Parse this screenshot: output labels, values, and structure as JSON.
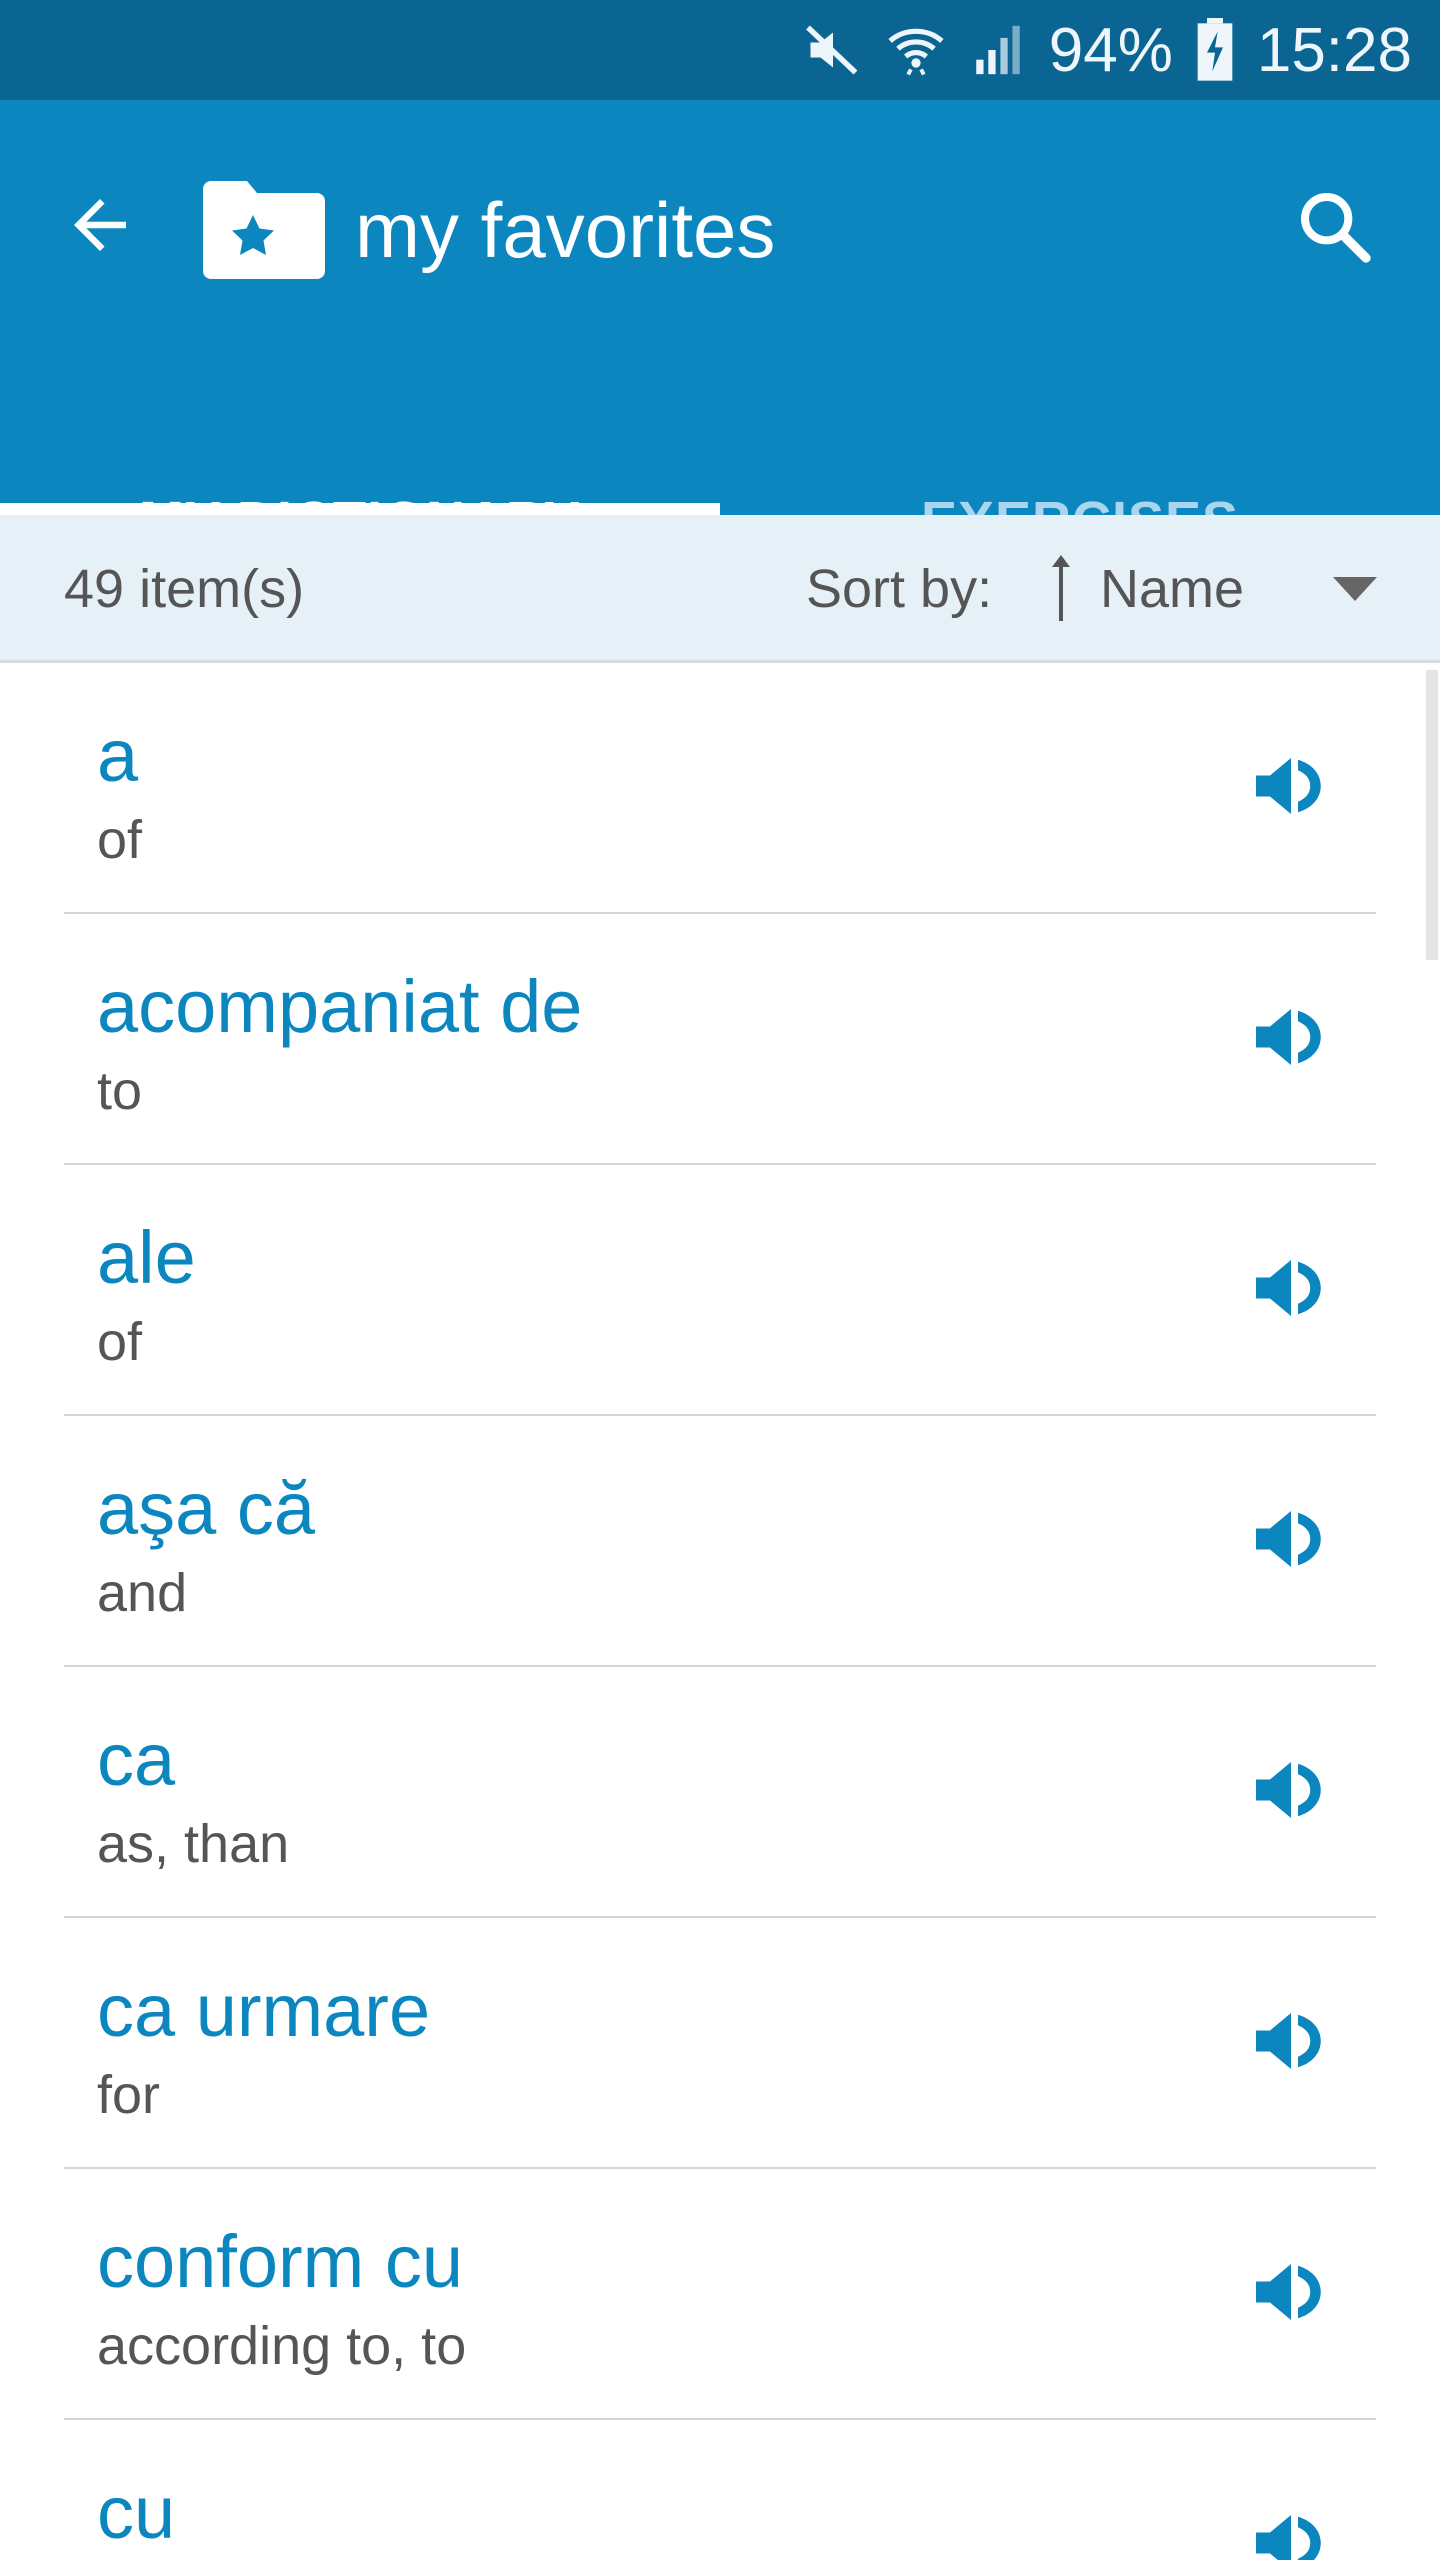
{
  "status_bar": {
    "battery_percent": "94%",
    "time": "15:28",
    "icons": [
      "mute-icon",
      "wifi-icon",
      "signal-icon",
      "battery-charging-icon"
    ]
  },
  "header": {
    "title": "my favorites",
    "back_icon": "back-arrow-icon",
    "folder_icon": "star-folder-icon",
    "search_icon": "search-icon"
  },
  "tabs": [
    {
      "label": "MY DICTIONARY",
      "active": true
    },
    {
      "label": "EXERCISES",
      "active": false
    }
  ],
  "sort_bar": {
    "item_count": "49 item(s)",
    "sort_label": "Sort by:",
    "sort_value": "Name",
    "sort_direction_icon": "sort-ascending-icon",
    "dropdown_icon": "dropdown-triangle-icon"
  },
  "entries": [
    {
      "word": "a",
      "translation": "of"
    },
    {
      "word": "acompaniat de",
      "translation": "to"
    },
    {
      "word": "ale",
      "translation": "of"
    },
    {
      "word": "aşa că",
      "translation": "and"
    },
    {
      "word": "ca",
      "translation": "as, than"
    },
    {
      "word": "ca urmare",
      "translation": "for"
    },
    {
      "word": "conform cu",
      "translation": "according to, to"
    },
    {
      "word": "cu",
      "translation": ""
    }
  ],
  "colors": {
    "status_bar": "#0b6593",
    "app_bar": "#0c86bf",
    "accent_text": "#0b86bf",
    "sort_bar_bg": "#e6f1f7",
    "secondary_text": "#555555"
  }
}
